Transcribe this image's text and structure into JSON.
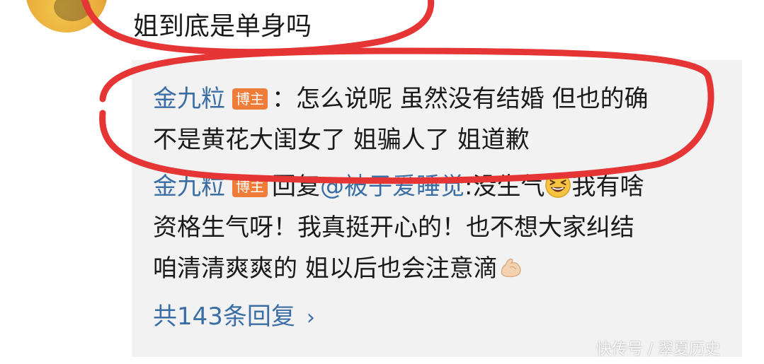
{
  "comment": {
    "text": "姐到底是单身吗"
  },
  "replies": [
    {
      "author": "金九粒",
      "badge": "博主",
      "separator": "：",
      "line1": "怎么说呢 虽然没有结婚 但也的确",
      "line2": "不是黄花大闺女了 姐骗人了 姐道歉"
    },
    {
      "author": "金九粒",
      "badge": "博主",
      "prefix": "回复",
      "mention": "@被子爱睡觉",
      "after_mention": ":没生气",
      "emoji1": "laughing-emoji",
      "line1_end": "我有啥",
      "line2": "资格生气呀！我真挺开心的！也不想大家纠结",
      "line3": "咱清清爽爽的 姐以后也会注意滴",
      "emoji2": "flexed-biceps-emoji"
    }
  ],
  "more_replies": {
    "label": "共143条回复"
  },
  "watermark": {
    "text": "快传号 / 翠夏历史"
  },
  "colors": {
    "link": "#3a6ea5",
    "badge": "#f07c3a",
    "annotation": "#e53535",
    "reply_bg": "#f2f2f2"
  }
}
